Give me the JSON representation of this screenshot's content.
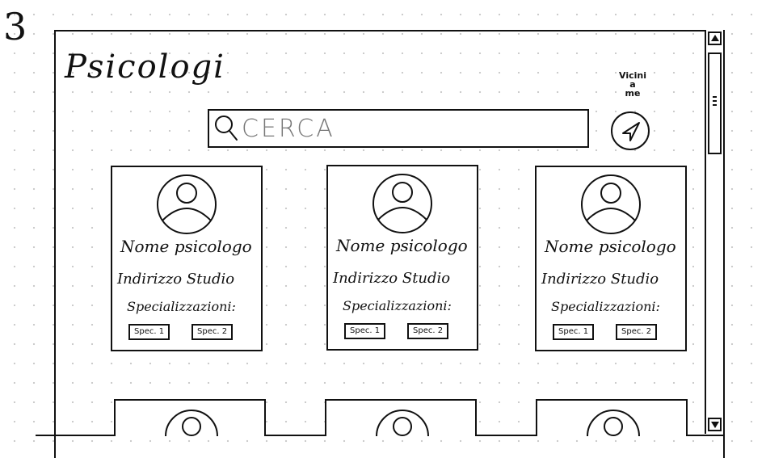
{
  "step_number": "3",
  "page": {
    "title": "Psicologi"
  },
  "search": {
    "placeholder": "CERCA"
  },
  "near_me": {
    "label_line1": "Vicini",
    "label_line2": "a",
    "label_line3": "me"
  },
  "cards": [
    {
      "name": "Nome psicologo",
      "address": "Indirizzo Studio",
      "specializations_label": "Specializzazioni:",
      "tags": [
        "Spec. 1",
        "Spec. 2"
      ]
    },
    {
      "name": "Nome psicologo",
      "address": "Indirizzo Studio",
      "specializations_label": "Specializzazioni:",
      "tags": [
        "Spec. 1",
        "Spec. 2"
      ]
    },
    {
      "name": "Nome psicologo",
      "address": "Indirizzo Studio",
      "specializations_label": "Specializzazioni:",
      "tags": [
        "Spec. 1",
        "Spec. 2"
      ]
    }
  ],
  "icons": {
    "search": "search-icon",
    "near_me": "navigation-arrow-icon",
    "avatar": "user-avatar-icon",
    "scroll_up": "arrow-up-icon",
    "scroll_down": "arrow-down-icon"
  },
  "colors": {
    "ink": "#111111",
    "placeholder": "#777777",
    "grid_dot": "#c9c9c9"
  }
}
